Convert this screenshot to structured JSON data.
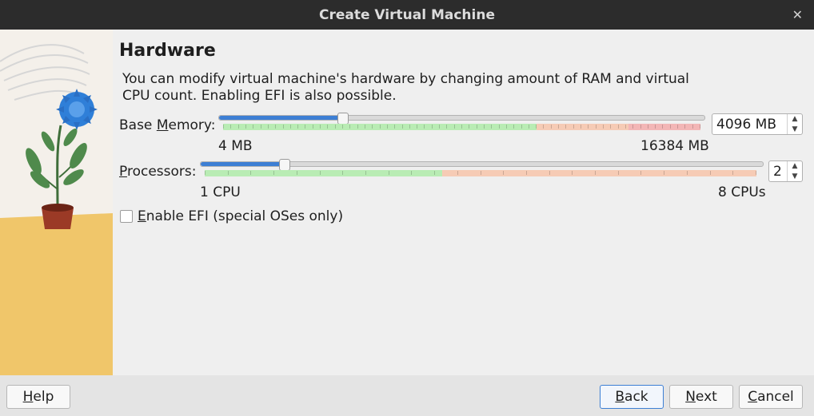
{
  "window": {
    "title": "Create Virtual Machine"
  },
  "page": {
    "heading": "Hardware",
    "description": "You can modify virtual machine's hardware by changing amount of RAM and virtual CPU count. Enabling EFI is also possible."
  },
  "memory": {
    "label_pre": "Base ",
    "label_mnemonic": "M",
    "label_post": "emory:",
    "min_label": "4 MB",
    "max_label": "16384 MB",
    "value_text": "4096 MB",
    "value_mb": 4096,
    "min_mb": 4,
    "max_mb": 16384
  },
  "processors": {
    "label_mnemonic": "P",
    "label_post": "rocessors:",
    "min_label": "1 CPU",
    "max_label": "8 CPUs",
    "value_text": "2",
    "value": 2,
    "min": 1,
    "max": 8
  },
  "efi": {
    "label_mnemonic": "E",
    "label_post": "nable EFI (special OSes only)",
    "checked": false
  },
  "buttons": {
    "help_mnemonic": "H",
    "help_rest": "elp",
    "back_mnemonic": "B",
    "back_rest": "ack",
    "next_mnemonic": "N",
    "next_rest": "ext",
    "cancel_mnemonic": "C",
    "cancel_rest": "ancel"
  },
  "colors": {
    "accent": "#3d7fd4",
    "zone_green": "#b9ecb4",
    "zone_orange": "#f6cbb5",
    "zone_red": "#f3b6b6",
    "titlebar": "#2c2c2c"
  },
  "icons": {
    "close": "close-icon",
    "checkbox": "checkbox-icon",
    "spin_up": "chevron-up-icon",
    "spin_down": "chevron-down-icon",
    "illustration": "plant-illustration"
  }
}
